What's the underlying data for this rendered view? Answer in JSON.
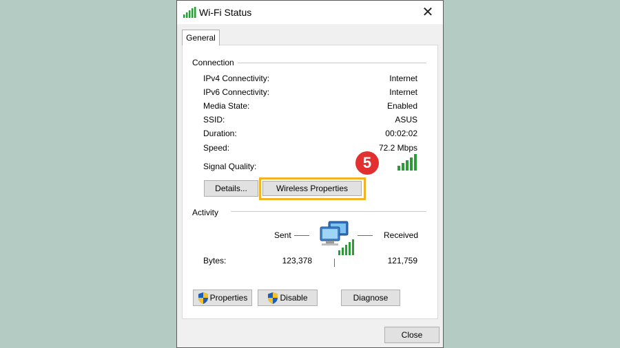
{
  "window": {
    "title": "Wi-Fi Status",
    "close_glyph": "✕"
  },
  "tabs": [
    {
      "label": "General"
    }
  ],
  "connection": {
    "heading": "Connection",
    "rows": [
      {
        "label": "IPv4 Connectivity:",
        "value": "Internet"
      },
      {
        "label": "IPv6 Connectivity:",
        "value": "Internet"
      },
      {
        "label": "Media State:",
        "value": "Enabled"
      },
      {
        "label": "SSID:",
        "value": "ASUS"
      },
      {
        "label": "Duration:",
        "value": "00:02:02"
      },
      {
        "label": "Speed:",
        "value": "72.2 Mbps"
      }
    ],
    "signal_label": "Signal Quality:",
    "signal_bars": 5,
    "details_button": "Details...",
    "wireless_properties_button": "Wireless Properties"
  },
  "step_badge": "5",
  "activity": {
    "heading": "Activity",
    "sent_label": "Sent",
    "received_label": "Received",
    "bytes_label": "Bytes:",
    "bytes_sent": "123,378",
    "bytes_received": "121,759"
  },
  "footer_buttons": {
    "properties": "Properties",
    "disable": "Disable",
    "diagnose": "Diagnose"
  },
  "close_button": "Close",
  "colors": {
    "background": "#b3cbc2",
    "signal_green": "#2e9b3a",
    "highlight": "#f0b323",
    "badge": "#e1302f"
  }
}
